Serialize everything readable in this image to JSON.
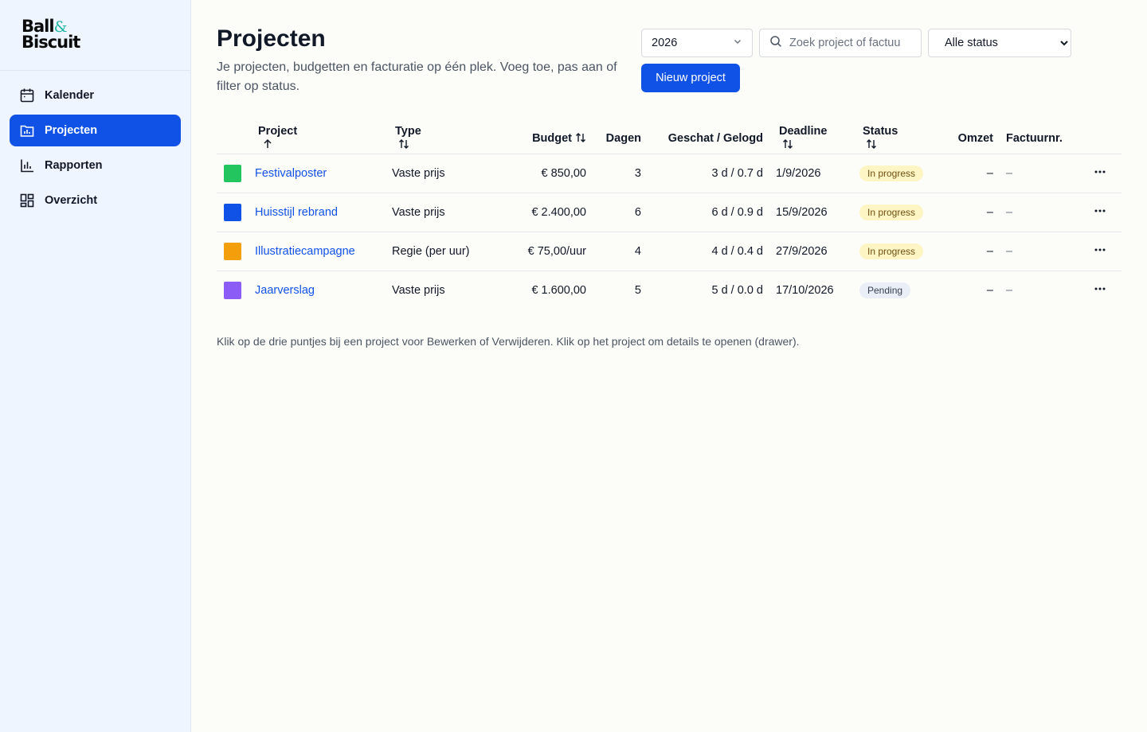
{
  "brand": {
    "line1": "Ball",
    "amp": "&",
    "line2": "Biscuit",
    "accent": "#1fb6a6"
  },
  "sidebar": {
    "items": [
      {
        "label": "Kalender",
        "icon": "calendar-icon"
      },
      {
        "label": "Projecten",
        "icon": "folder-chart-icon",
        "active": true
      },
      {
        "label": "Rapporten",
        "icon": "bar-chart-icon"
      },
      {
        "label": "Overzicht",
        "icon": "dashboard-icon"
      }
    ]
  },
  "header": {
    "title": "Projecten",
    "subtitle": "Je projecten, budgetten en facturatie op één plek. Voeg toe, pas aan of filter op status."
  },
  "filters": {
    "year": "2026",
    "search_placeholder": "Zoek project of factuur",
    "status_selected": "Alle status",
    "new_button": "Nieuw project"
  },
  "table": {
    "columns": [
      "Project",
      "Type",
      "Budget",
      "Dagen",
      "Geschat / Gelogd",
      "Deadline",
      "Status",
      "Omzet",
      "Factuurnr."
    ],
    "rows": [
      {
        "color": "#22c55e",
        "project": "Festivalposter",
        "type": "Vaste prijs",
        "budget": "€ 850,00",
        "dagen": "3",
        "geschat": "3 d / 0.7 d",
        "deadline": "1/9/2026",
        "status": "In progress",
        "omzet": "–",
        "factuurnr": "–"
      },
      {
        "color": "#1152e6",
        "project": "Huisstijl rebrand",
        "type": "Vaste prijs",
        "budget": "€ 2.400,00",
        "dagen": "6",
        "geschat": "6 d / 0.9 d",
        "deadline": "15/9/2026",
        "status": "In progress",
        "omzet": "–",
        "factuurnr": "–"
      },
      {
        "color": "#f59e0b",
        "project": "Illustratiecampagne",
        "type": "Regie (per uur)",
        "budget": "€ 75,00/uur",
        "dagen": "4",
        "geschat": "4 d / 0.4 d",
        "deadline": "27/9/2026",
        "status": "In progress",
        "omzet": "–",
        "factuurnr": "–"
      },
      {
        "color": "#8b5cf6",
        "project": "Jaarverslag",
        "type": "Vaste prijs",
        "budget": "€ 1.600,00",
        "dagen": "5",
        "geschat": "5 d / 0.0 d",
        "deadline": "17/10/2026",
        "status": "Pending",
        "omzet": "–",
        "factuurnr": "–"
      }
    ]
  },
  "footnote": "Klik op de drie puntjes bij een project voor Bewerken of Verwijderen. Klik op het project om details te openen (drawer)."
}
